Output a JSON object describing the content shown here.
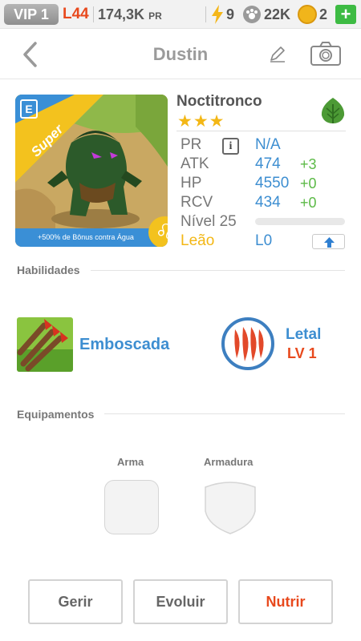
{
  "status": {
    "vip": "VIP 1",
    "level": "L44",
    "power_value": "174,3K",
    "power_unit": "PR",
    "energy": "9",
    "paws": "22K",
    "coins": "2",
    "plus": "+"
  },
  "header": {
    "title": "Dustin"
  },
  "card": {
    "rarity": "Super",
    "edition_badge": "E",
    "bonus": "+500% de Bônus contra Água",
    "sign_symbol": "♌"
  },
  "monster": {
    "name": "Noctitronco",
    "stars": "★★★",
    "stats": [
      {
        "label": "PR",
        "value": "N/A",
        "bonus": ""
      },
      {
        "label": "ATK",
        "value": "474",
        "bonus": "+3"
      },
      {
        "label": "HP",
        "value": "4550",
        "bonus": "+0"
      },
      {
        "label": "RCV",
        "value": "434",
        "bonus": "+0"
      }
    ],
    "info_icon": "i",
    "level_label": "Nível 25",
    "level_progress": 0,
    "sign_label": "Leão",
    "sign_level": "L0"
  },
  "skills": {
    "section": "Habilidades",
    "items": [
      {
        "name": "Emboscada"
      },
      {
        "name": "Letal",
        "level": "LV 1"
      }
    ]
  },
  "equipment": {
    "section": "Equipamentos",
    "weapon": "Arma",
    "armor": "Armadura"
  },
  "actions": {
    "manage": "Gerir",
    "evolve": "Evoluir",
    "feed": "Nutrir"
  },
  "colors": {
    "accent_blue": "#3d8ed1",
    "accent_orange": "#e8491d",
    "bonus_green": "#5cba47",
    "star_gold": "#f3b715"
  }
}
